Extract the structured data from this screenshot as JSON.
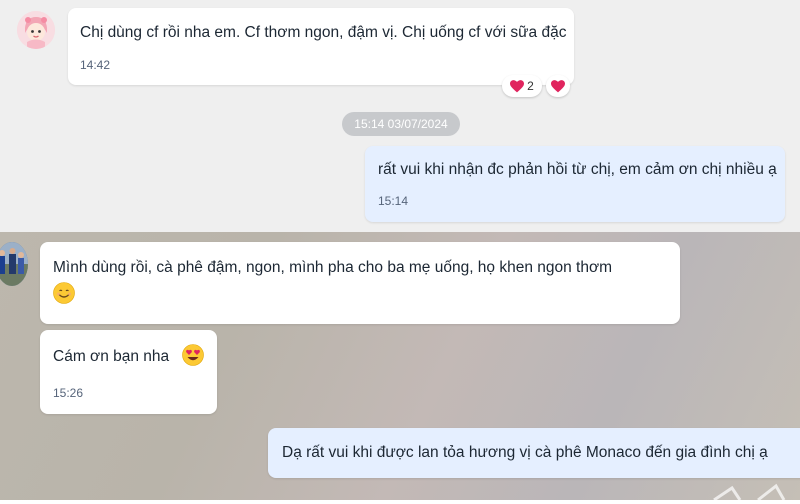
{
  "conversation": {
    "date_divider": "15:14 03/07/2024",
    "messages": [
      {
        "sender": "contact",
        "text": "Chị dùng cf rồi nha em. Cf thơm ngon, đậm vị. Chị uống cf với sữa đặc",
        "time": "14:42",
        "reactions": [
          {
            "icon": "heart-icon",
            "count": "2"
          },
          {
            "icon": "heart-icon",
            "count": ""
          }
        ]
      },
      {
        "sender": "me",
        "text": "rất vui khi nhận đc phản hồi từ chị, em cảm ơn chị nhiều ạ",
        "time": "15:14"
      }
    ]
  },
  "lower_conversation": {
    "messages": [
      {
        "sender": "contact",
        "text": "Mình dùng rồi, cà phê đậm, ngon, mình pha cho ba mẹ uống, họ khen ngon thơm",
        "emoji": "smiling-face-icon"
      },
      {
        "sender": "contact",
        "text": "Cám ơn bạn nha",
        "emoji": "heart-eyes-icon",
        "time": "15:26"
      },
      {
        "sender": "me",
        "text": "Dạ rất vui khi được lan tỏa hương vị cà phê Monaco đến gia đình chị ạ"
      }
    ]
  },
  "colors": {
    "outgoing_bubble": "#e5efff",
    "incoming_bubble": "#ffffff",
    "chat_background": "#efefef",
    "heart": "#e0245e"
  }
}
